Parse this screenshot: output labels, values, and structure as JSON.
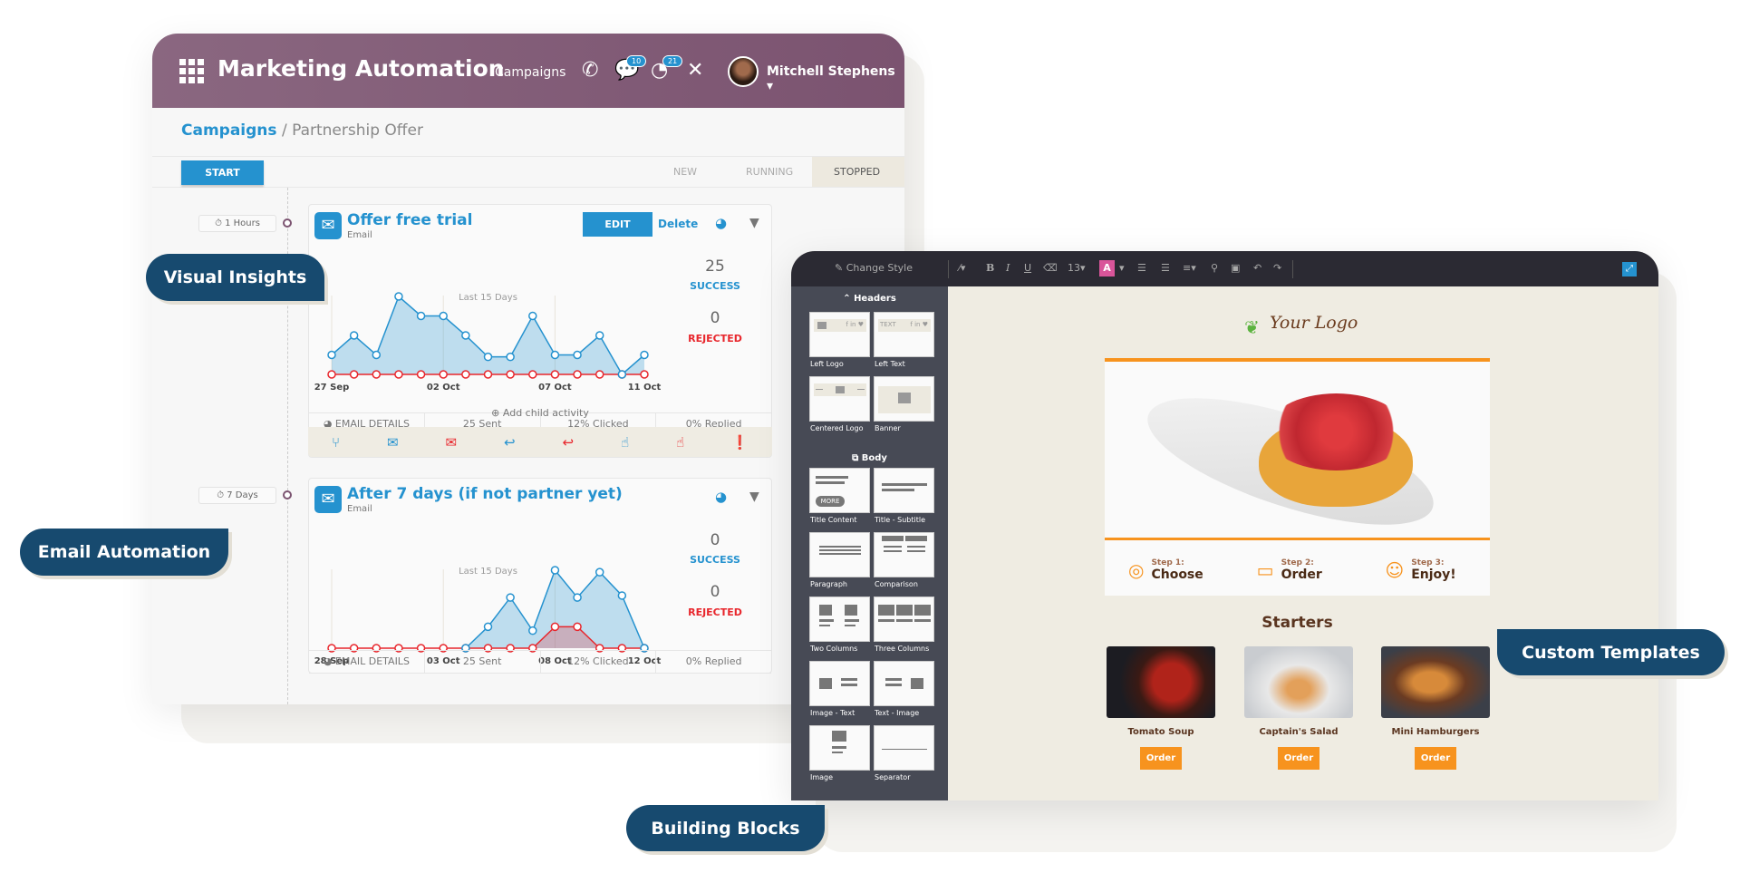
{
  "app": {
    "title": "Marketing Automation",
    "nav": "Campaigns",
    "messages_badge": "10",
    "activities_badge": "21",
    "user": "Mitchell Stephens"
  },
  "breadcrumb": {
    "parent": "Campaigns",
    "separator": "/",
    "current": "Partnership Offer"
  },
  "status": {
    "start_label": "START",
    "stages": [
      "NEW",
      "RUNNING",
      "STOPPED"
    ],
    "active_stage": "STOPPED"
  },
  "activities": [
    {
      "delay": "1 Hours",
      "title": "Offer free trial",
      "type": "Email",
      "edit_label": "EDIT",
      "delete_label": "Delete",
      "period": "Last 15 Days",
      "success_count": "25",
      "success_label": "SUCCESS",
      "rejected_count": "0",
      "rejected_label": "REJECTED",
      "details_label": "EMAIL DETAILS",
      "sent": "25 Sent",
      "clicked": "12% Clicked",
      "replied": "0% Replied",
      "add_child": "Add child activity"
    },
    {
      "delay": "7 Days",
      "title": "After 7 days (if not partner yet)",
      "type": "Email",
      "period": "Last 15 Days",
      "success_count": "0",
      "success_label": "SUCCESS",
      "rejected_count": "0",
      "rejected_label": "REJECTED",
      "details_label": "EMAIL DETAILS",
      "sent": "25 Sent",
      "clicked": "12% Clicked",
      "replied": "0% Replied"
    }
  ],
  "chart_data": [
    {
      "type": "line",
      "title": "Last 15 Days",
      "x_ticks": [
        "27 Sep",
        "02 Oct",
        "07 Oct",
        "11 Oct"
      ],
      "x_tick_index": [
        0,
        5,
        10,
        14
      ],
      "series": [
        {
          "color": "#2592cf",
          "values": [
            1,
            2,
            1,
            4,
            3,
            3,
            2,
            0.9,
            0.9,
            3,
            1,
            1,
            2,
            0,
            1
          ]
        },
        {
          "color": "#e8262c",
          "values": [
            0,
            0,
            0,
            0,
            0,
            0,
            0,
            0,
            0,
            0,
            0,
            0,
            0,
            0,
            0
          ]
        }
      ],
      "ylim": [
        0,
        4
      ]
    },
    {
      "type": "line",
      "title": "Last 15 Days",
      "x_ticks": [
        "28 Sep",
        "03 Oct",
        "08 Oct",
        "12 Oct"
      ],
      "x_tick_index": [
        0,
        5,
        10,
        14
      ],
      "series": [
        {
          "color": "#2592cf",
          "start_index": 6,
          "values": [
            0,
            0,
            0,
            0,
            0,
            0,
            0,
            1.1,
            2.6,
            0.9,
            4,
            2.6,
            3.9,
            2.7,
            0
          ]
        },
        {
          "color": "#e8262c",
          "values": [
            0,
            0,
            0,
            0,
            0,
            0,
            0,
            0,
            0,
            0,
            1.1,
            1.1,
            0,
            0,
            0
          ]
        }
      ],
      "ylim": [
        0,
        4
      ]
    }
  ],
  "action_icons": [
    {
      "name": "branch",
      "color": "#2592cf",
      "glyph": "⑂"
    },
    {
      "name": "mail-open",
      "color": "#2592cf",
      "glyph": "✉"
    },
    {
      "name": "mail-open",
      "color": "#e8262c",
      "glyph": "✉"
    },
    {
      "name": "reply",
      "color": "#2592cf",
      "glyph": "↩"
    },
    {
      "name": "reply",
      "color": "#e8262c",
      "glyph": "↩"
    },
    {
      "name": "pointer",
      "color": "#2592cf",
      "glyph": "☝"
    },
    {
      "name": "pointer",
      "color": "#e8262c",
      "glyph": "☝"
    },
    {
      "name": "exclamation",
      "color": "#e8262c",
      "glyph": "❗"
    }
  ],
  "callouts": {
    "visual": "Visual Insights",
    "email": "Email Automation",
    "blocks": "Building Blocks",
    "templates": "Custom Templates"
  },
  "editor": {
    "change_style": "Change Style",
    "font_size": "13",
    "text_color_label": "A",
    "headers_label": "Headers",
    "body_label": "Body",
    "header_blocks": [
      "Left Logo",
      "Left Text",
      "Centered Logo",
      "Banner"
    ],
    "body_blocks": [
      "Title Content",
      "Title - Subtitle",
      "Paragraph",
      "Comparison",
      "Two Columns",
      "Three Columns",
      "Image - Text",
      "Text - Image",
      "Image",
      "Separator"
    ],
    "thumb_text": "TEXT",
    "thumb_social": "f in ♥",
    "more_label": "MORE"
  },
  "template": {
    "logo": "Your Logo",
    "steps": [
      {
        "label": "Step 1:",
        "value": "Choose"
      },
      {
        "label": "Step 2:",
        "value": "Order"
      },
      {
        "label": "Step 3:",
        "value": "Enjoy!"
      }
    ],
    "section": "Starters",
    "items": [
      {
        "name": "Tomato Soup",
        "button": "Order"
      },
      {
        "name": "Captain's Salad",
        "button": "Order"
      },
      {
        "name": "Mini Hamburgers",
        "button": "Order"
      }
    ],
    "accent": "#f7931e"
  }
}
